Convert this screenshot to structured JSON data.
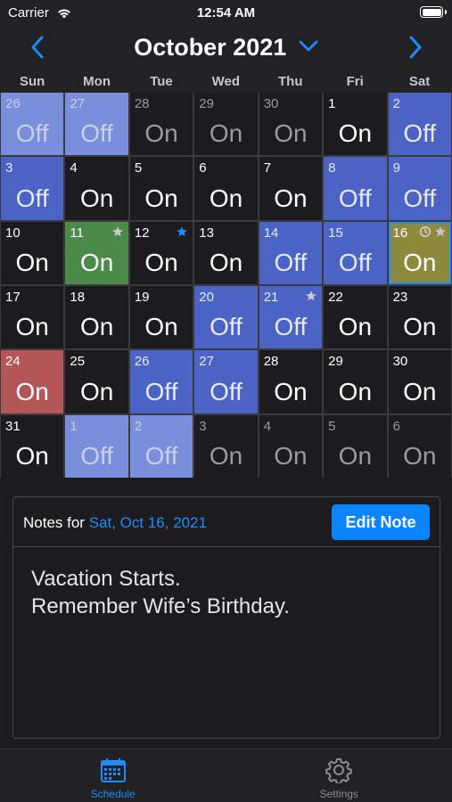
{
  "status_bar": {
    "carrier": "Carrier",
    "time": "12:54 AM"
  },
  "header": {
    "title": "October 2021"
  },
  "weekdays": [
    "Sun",
    "Mon",
    "Tue",
    "Wed",
    "Thu",
    "Fri",
    "Sat"
  ],
  "days": [
    {
      "num": "26",
      "status": "Off",
      "style": "off",
      "outside": true
    },
    {
      "num": "27",
      "status": "Off",
      "style": "off",
      "outside": true
    },
    {
      "num": "28",
      "status": "On",
      "style": "on",
      "outside": true
    },
    {
      "num": "29",
      "status": "On",
      "style": "on",
      "outside": true
    },
    {
      "num": "30",
      "status": "On",
      "style": "on",
      "outside": true
    },
    {
      "num": "1",
      "status": "On",
      "style": "on",
      "outside": false
    },
    {
      "num": "2",
      "status": "Off",
      "style": "off",
      "outside": false
    },
    {
      "num": "3",
      "status": "Off",
      "style": "off",
      "outside": false
    },
    {
      "num": "4",
      "status": "On",
      "style": "on",
      "outside": false
    },
    {
      "num": "5",
      "status": "On",
      "style": "on",
      "outside": false
    },
    {
      "num": "6",
      "status": "On",
      "style": "on",
      "outside": false
    },
    {
      "num": "7",
      "status": "On",
      "style": "on",
      "outside": false
    },
    {
      "num": "8",
      "status": "Off",
      "style": "off",
      "outside": false
    },
    {
      "num": "9",
      "status": "Off",
      "style": "off",
      "outside": false
    },
    {
      "num": "10",
      "status": "On",
      "style": "on",
      "outside": false
    },
    {
      "num": "11",
      "status": "On",
      "style": "green",
      "outside": false,
      "icons": [
        "star-icon-gray"
      ]
    },
    {
      "num": "12",
      "status": "On",
      "style": "on",
      "outside": false,
      "icons": [
        "star-icon-blue"
      ]
    },
    {
      "num": "13",
      "status": "On",
      "style": "on",
      "outside": false
    },
    {
      "num": "14",
      "status": "Off",
      "style": "off",
      "outside": false
    },
    {
      "num": "15",
      "status": "Off",
      "style": "off",
      "outside": false
    },
    {
      "num": "16",
      "status": "On",
      "style": "olive",
      "outside": false,
      "icons": [
        "clock-icon",
        "star-icon-gray"
      ],
      "selected": true
    },
    {
      "num": "17",
      "status": "On",
      "style": "on",
      "outside": false
    },
    {
      "num": "18",
      "status": "On",
      "style": "on",
      "outside": false
    },
    {
      "num": "19",
      "status": "On",
      "style": "on",
      "outside": false
    },
    {
      "num": "20",
      "status": "Off",
      "style": "off",
      "outside": false
    },
    {
      "num": "21",
      "status": "Off",
      "style": "off",
      "outside": false,
      "icons": [
        "star-icon-gray"
      ]
    },
    {
      "num": "22",
      "status": "On",
      "style": "on",
      "outside": false
    },
    {
      "num": "23",
      "status": "On",
      "style": "on",
      "outside": false
    },
    {
      "num": "24",
      "status": "On",
      "style": "red",
      "outside": false
    },
    {
      "num": "25",
      "status": "On",
      "style": "on",
      "outside": false
    },
    {
      "num": "26",
      "status": "Off",
      "style": "off",
      "outside": false
    },
    {
      "num": "27",
      "status": "Off",
      "style": "off",
      "outside": false
    },
    {
      "num": "28",
      "status": "On",
      "style": "on",
      "outside": false
    },
    {
      "num": "29",
      "status": "On",
      "style": "on",
      "outside": false
    },
    {
      "num": "30",
      "status": "On",
      "style": "on",
      "outside": false
    },
    {
      "num": "31",
      "status": "On",
      "style": "on",
      "outside": false
    },
    {
      "num": "1",
      "status": "Off",
      "style": "off",
      "outside": true
    },
    {
      "num": "2",
      "status": "Off",
      "style": "off",
      "outside": true
    },
    {
      "num": "3",
      "status": "On",
      "style": "on",
      "outside": true
    },
    {
      "num": "4",
      "status": "On",
      "style": "on",
      "outside": true
    },
    {
      "num": "5",
      "status": "On",
      "style": "on",
      "outside": true
    },
    {
      "num": "6",
      "status": "On",
      "style": "on",
      "outside": true
    }
  ],
  "notes": {
    "label": "Notes for",
    "date": "Sat, Oct 16, 2021",
    "edit_button": "Edit Note",
    "lines": [
      "Vacation Starts.",
      "Remember Wife’s Birthday."
    ]
  },
  "tabs": [
    {
      "label": "Schedule",
      "icon": "calendar-icon",
      "active": true
    },
    {
      "label": "Settings",
      "icon": "gear-icon",
      "active": false
    }
  ],
  "colors": {
    "accent": "#0a84ff",
    "off_day": "#4b63c4",
    "green_day": "#4c8a4a",
    "red_day": "#b45657",
    "olive_day": "#8d8a3e"
  }
}
